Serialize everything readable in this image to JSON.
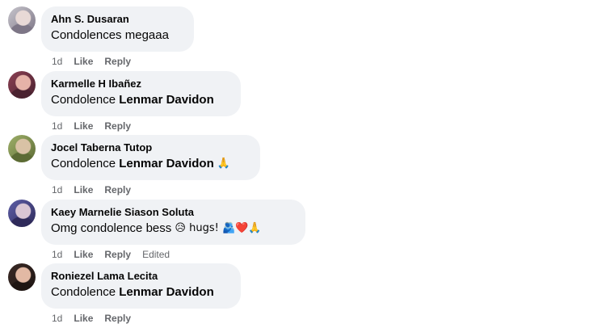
{
  "comments": [
    {
      "author": "Ahn S. Dusaran",
      "text": "Condolences megaaa",
      "mention": "",
      "suffix": "",
      "time": "1d",
      "like_label": "Like",
      "reply_label": "Reply",
      "edited_label": "",
      "avatar_colors": [
        "#c7c5cc",
        "#e8d9d6",
        "#7d7686"
      ]
    },
    {
      "author": "Karmelle H Ibañez",
      "text": "Condolence ",
      "mention": "Lenmar Davidon",
      "suffix": "",
      "time": "1d",
      "like_label": "Like",
      "reply_label": "Reply",
      "edited_label": "",
      "avatar_colors": [
        "#8b3f52",
        "#e6b2a8",
        "#4a2230"
      ]
    },
    {
      "author": "Jocel Taberna Tutop",
      "text": "Condolence ",
      "mention": "Lenmar Davidon",
      "suffix": "🙏",
      "time": "1d",
      "like_label": "Like",
      "reply_label": "Reply",
      "edited_label": "",
      "avatar_colors": [
        "#9fb06a",
        "#d9c2a5",
        "#5c6b34"
      ]
    },
    {
      "author": "Kaey Marnelie Siason Soluta",
      "text": "Omg condolence bess ",
      "mention": "",
      "suffix": "😥 hugs! 🫂❤️🙏",
      "time": "1d",
      "like_label": "Like",
      "reply_label": "Reply",
      "edited_label": "Edited",
      "avatar_colors": [
        "#5e5fa8",
        "#d9c6d4",
        "#2e2a5a"
      ]
    },
    {
      "author": "Roniezel Lama Lecita",
      "text": "Condolence ",
      "mention": "Lenmar Davidon",
      "suffix": "",
      "time": "1d",
      "like_label": "Like",
      "reply_label": "Reply",
      "edited_label": "",
      "avatar_colors": [
        "#3a2a26",
        "#e2b9a4",
        "#1e1512"
      ]
    }
  ]
}
